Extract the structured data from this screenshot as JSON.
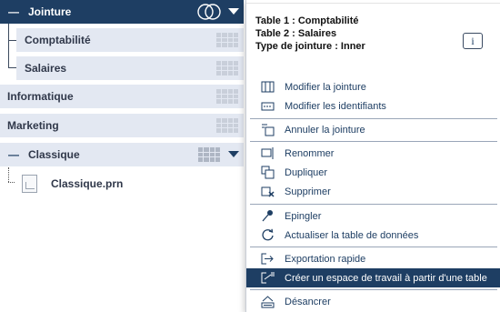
{
  "tree": {
    "jointure": {
      "label": "Jointure",
      "expanded": true
    },
    "children": [
      {
        "label": "Comptabilité"
      },
      {
        "label": "Salaires"
      }
    ],
    "informatique": {
      "label": "Informatique"
    },
    "marketing": {
      "label": "Marketing"
    },
    "classique": {
      "label": "Classique",
      "expanded": true
    },
    "file": {
      "label": "Classique.prn"
    }
  },
  "menu": {
    "info": {
      "table1": "Table 1 : Comptabilité",
      "table2": "Table 2 : Salaires",
      "join_type": "Type de jointure : Inner"
    },
    "info_button": "i",
    "items": [
      {
        "label": "Modifier la jointure",
        "icon": "edit-join-icon"
      },
      {
        "label": "Modifier les identifiants",
        "icon": "edit-identifiers-icon"
      },
      {
        "label": "Annuler la jointure",
        "icon": "cancel-join-icon"
      },
      {
        "label": "Renommer",
        "icon": "rename-icon"
      },
      {
        "label": "Dupliquer",
        "icon": "duplicate-icon"
      },
      {
        "label": "Supprimer",
        "icon": "delete-icon"
      },
      {
        "label": "Epingler",
        "icon": "pin-icon"
      },
      {
        "label": "Actualiser la table de données",
        "icon": "refresh-icon"
      },
      {
        "label": "Exportation rapide",
        "icon": "quick-export-icon"
      },
      {
        "label": "Créer un espace de travail à partir d'une table",
        "icon": "create-workspace-icon",
        "highlighted": true
      },
      {
        "label": "Désancrer",
        "icon": "undock-icon"
      }
    ]
  },
  "colors": {
    "accent": "#1e3e63",
    "row_light": "#e3e8f2",
    "highlight": "#1e3e63"
  }
}
